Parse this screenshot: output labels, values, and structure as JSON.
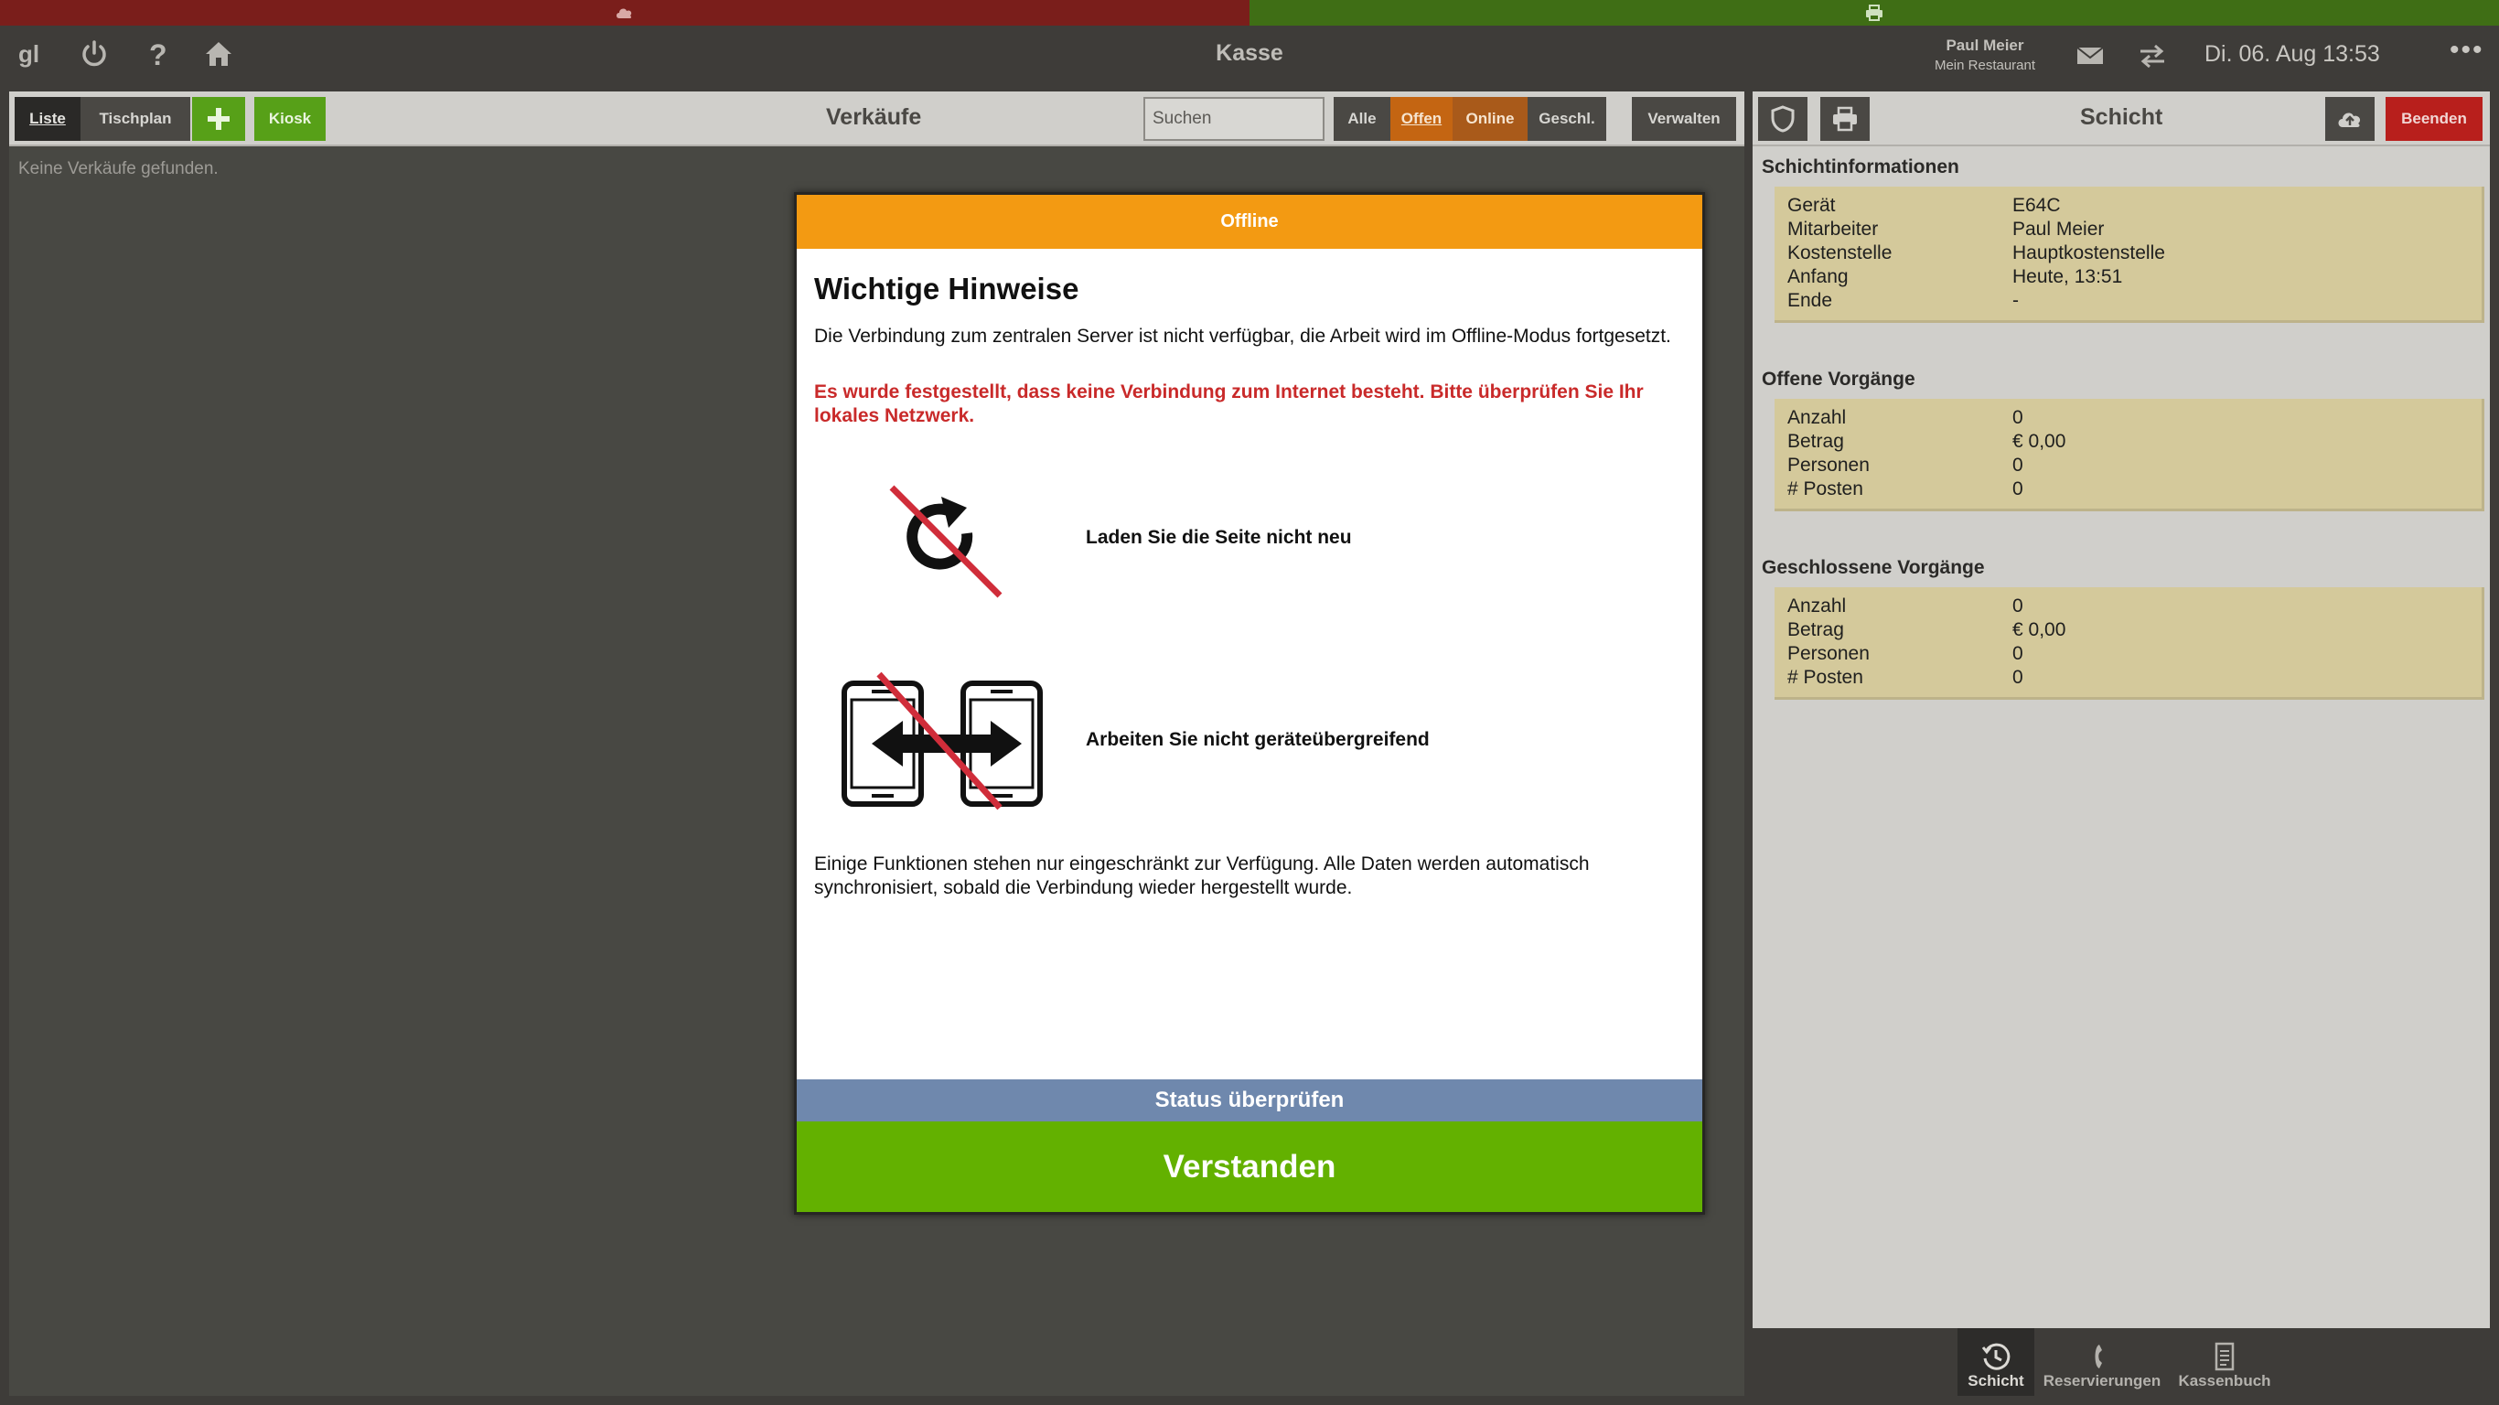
{
  "status_strip": {
    "left_color": "#7a1e1b",
    "right_color": "#3f6e15",
    "left_icon": "cloud-icon",
    "right_icon": "printer-icon"
  },
  "topbar": {
    "icons": [
      "logo-icon",
      "power-icon",
      "help-icon",
      "home-icon"
    ],
    "title": "Kasse",
    "user_name": "Paul Meier",
    "restaurant": "Mein Restaurant",
    "datetime": "Di. 06. Aug 13:53",
    "more": "•••"
  },
  "sales": {
    "tab_list": "Liste",
    "tab_table_plan": "Tischplan",
    "add_icon": "plus-icon",
    "kiosk": "Kiosk",
    "title": "Verkäufe",
    "search_placeholder": "Suchen",
    "filters": {
      "all": "Alle",
      "open": "Offen",
      "online": "Online",
      "closed": "Geschl."
    },
    "manage": "Verwalten",
    "empty": "Keine Verkäufe gefunden."
  },
  "shift": {
    "title": "Schicht",
    "end": "Beenden",
    "toolbar_icons": [
      "shield-icon",
      "print-icon",
      "cloud-upload-icon"
    ],
    "info_title": "Schichtinformationen",
    "info": [
      {
        "key": "Gerät",
        "value": "E64C"
      },
      {
        "key": "Mitarbeiter",
        "value": "Paul Meier"
      },
      {
        "key": "Kostenstelle",
        "value": "Hauptkostenstelle"
      },
      {
        "key": "Anfang",
        "value": "Heute, 13:51"
      },
      {
        "key": "Ende",
        "value": "-"
      }
    ],
    "open_title": "Offene Vorgänge",
    "open": [
      {
        "key": "Anzahl",
        "value": "0"
      },
      {
        "key": "Betrag",
        "value": "€ 0,00"
      },
      {
        "key": "Personen",
        "value": "0"
      },
      {
        "key": "# Posten",
        "value": "0"
      }
    ],
    "closed_title": "Geschlossene Vorgänge",
    "closed": [
      {
        "key": "Anzahl",
        "value": "0"
      },
      {
        "key": "Betrag",
        "value": "€ 0,00"
      },
      {
        "key": "Personen",
        "value": "0"
      },
      {
        "key": "# Posten",
        "value": "0"
      }
    ]
  },
  "bottom_nav": {
    "shift": "Schicht",
    "reservations": "Reservierungen",
    "cashbook": "Kassenbuch"
  },
  "modal": {
    "header": "Offline",
    "header_color": "#f39a12",
    "title": "Wichtige Hinweise",
    "intro": "Die Verbindung zum zentralen Server ist nicht verfügbar, die Arbeit wird im Offline-Modus fortgesetzt.",
    "warning": "Es wurde festgestellt, dass keine Verbindung zum Internet besteht. Bitte überprüfen Sie Ihr lokales Netzwerk.",
    "hint_reload": "Laden Sie die Seite nicht neu",
    "hint_devices": "Arbeiten Sie nicht geräteübergreifend",
    "footer_text": "Einige Funktionen stehen nur eingeschränkt zur Verfügung. Alle Daten werden automatisch synchronisiert, sobald die Verbindung wieder hergestellt wurde.",
    "btn_status": "Status überprüfen",
    "btn_ok": "Verstanden"
  }
}
